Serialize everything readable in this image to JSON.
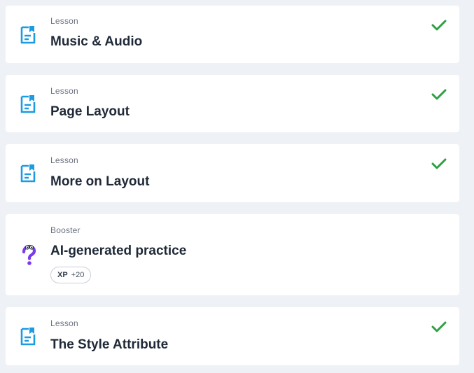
{
  "items": [
    {
      "kind": "Lesson",
      "title": "Music & Audio",
      "completed": true,
      "icon": "lesson-doc-icon"
    },
    {
      "kind": "Lesson",
      "title": "Page Layout",
      "completed": true,
      "icon": "lesson-doc-icon"
    },
    {
      "kind": "Lesson",
      "title": "More on Layout",
      "completed": true,
      "icon": "lesson-doc-icon"
    },
    {
      "kind": "Booster",
      "title": "AI-generated practice",
      "completed": false,
      "icon": "question-mark-icon",
      "xp_label": "XP",
      "xp_value": "+20"
    },
    {
      "kind": "Lesson",
      "title": "The Style Attribute",
      "completed": true,
      "icon": "lesson-doc-icon"
    }
  ],
  "colors": {
    "lesson_icon": "#1d9be2",
    "booster_icon": "#7c3aed",
    "check": "#2ea043",
    "card_bg": "#ffffff",
    "page_bg": "#eef1f5"
  }
}
